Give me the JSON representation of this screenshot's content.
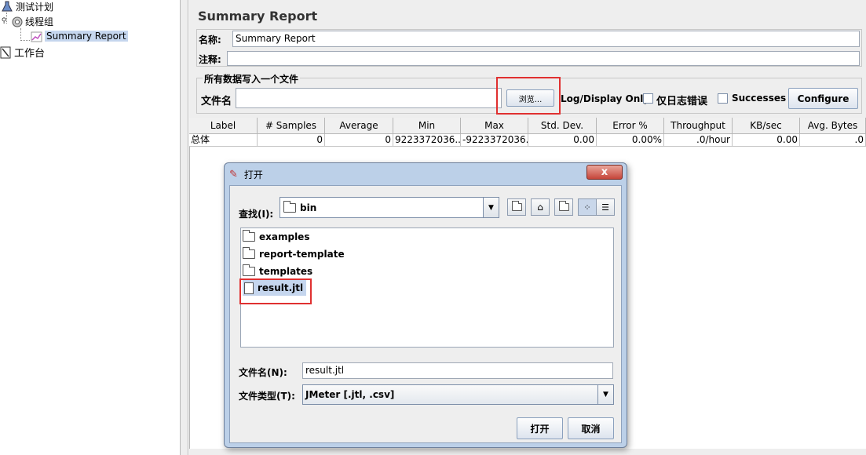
{
  "tree": {
    "items": [
      {
        "label": "测试计划",
        "icon": "flask-icon"
      },
      {
        "label": "线程组",
        "icon": "gear-icon"
      },
      {
        "label": "Summary Report",
        "icon": "chart-icon"
      },
      {
        "label": "工作台",
        "icon": "workbench-icon"
      }
    ]
  },
  "panel": {
    "title": "Summary Report",
    "name_label": "名称:",
    "name_value": "Summary Report",
    "comment_label": "注释:",
    "comment_value": "",
    "filegroup_title": "所有数据写入一个文件",
    "filename_label": "文件名",
    "filename_value": "",
    "browse_label": "浏览...",
    "logdisplay_label": "Log/Display Only:",
    "errors_label": "仅日志错误",
    "successes_label": "Successes",
    "configure_label": "Configure"
  },
  "table": {
    "headers": [
      "Label",
      "# Samples",
      "Average",
      "Min",
      "Max",
      "Std. Dev.",
      "Error %",
      "Throughput",
      "KB/sec",
      "Avg. Bytes"
    ],
    "rows": [
      [
        "总体",
        "0",
        "0",
        "9223372036...",
        "-9223372036...",
        "0.00",
        "0.00%",
        ".0/hour",
        "0.00",
        ".0"
      ]
    ]
  },
  "dialog": {
    "title": "打开",
    "lookin_label": "查找(I):",
    "lookin_value": "bin",
    "files": [
      {
        "name": "examples",
        "type": "folder"
      },
      {
        "name": "report-template",
        "type": "folder"
      },
      {
        "name": "templates",
        "type": "folder"
      },
      {
        "name": "result.jtl",
        "type": "file"
      }
    ],
    "filename_label": "文件名(N):",
    "filename_value": "result.jtl",
    "filetype_label": "文件类型(T):",
    "filetype_value": "JMeter [.jtl, .csv]",
    "open_label": "打开",
    "cancel_label": "取消",
    "close_glyph": "x"
  },
  "colors": {
    "highlight_red": "#e03030",
    "selection_blue": "#c5d6ee",
    "panel_bg": "#eeeeee"
  }
}
